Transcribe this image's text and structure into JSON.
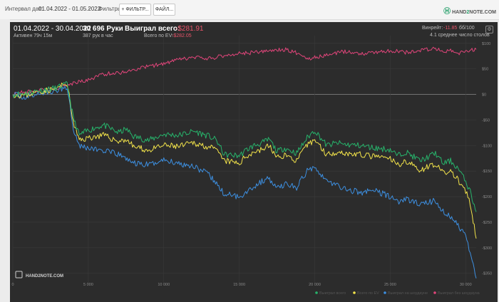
{
  "toolbar": {
    "date_label": "Интервал дат:",
    "date_value": "01.04.2022 - 01.05.2022",
    "filters_label": "Фильтры:",
    "filter_button": "+ ФИЛЬТР...",
    "file_button": "ФАЙЛ...",
    "logo_prefix": "HAND",
    "logo_two": "2",
    "logo_suffix": "NOTE.COM"
  },
  "summary": {
    "period": "01.04.2022 - 30.04.2022",
    "active": "Активен 79ч 15м",
    "hands": "30 696 Руки",
    "hands_per_hour": "387 рук в час",
    "won_label": "Выиграл всего:",
    "won_value": "-$281.91",
    "ev_label": "Всего по EV:",
    "ev_value": "-$282.05",
    "winrate_label": "Винрейт:",
    "winrate_value": "-11.85",
    "winrate_bb": "бб/100",
    "avg_tables": "4.1 среднее число столов"
  },
  "watermark": "HAND2NOTE.COM",
  "colors": {
    "won": "#27b36b",
    "ev": "#f2e34a",
    "showdown": "#3d8fe0",
    "nonshowdown": "#e0457a",
    "panel": "#2c2c2c"
  },
  "chart_data": {
    "type": "line",
    "x_ticks": [
      "0",
      "5 000",
      "10 000",
      "15 000",
      "20 000",
      "25 000",
      "30 000"
    ],
    "y_ticks": [
      "$100",
      "$50",
      "$0",
      "-$50",
      "-$100",
      "-$150",
      "-$200",
      "-$250",
      "-$300",
      "-$350"
    ],
    "xlim": [
      0,
      30696
    ],
    "ylim": [
      -370,
      115
    ],
    "grid": true,
    "legend_position": "bottom-right",
    "series": [
      {
        "name": "Выиграл всего",
        "color": "#27b36b",
        "points": [
          [
            0,
            0
          ],
          [
            800,
            2
          ],
          [
            1800,
            8
          ],
          [
            2800,
            12
          ],
          [
            3600,
            20
          ],
          [
            4000,
            -45
          ],
          [
            4400,
            -80
          ],
          [
            5000,
            -70
          ],
          [
            6000,
            -60
          ],
          [
            7000,
            -75
          ],
          [
            7500,
            -68
          ],
          [
            8000,
            -82
          ],
          [
            9000,
            -90
          ],
          [
            10000,
            -78
          ],
          [
            11000,
            -80
          ],
          [
            12000,
            -72
          ],
          [
            13000,
            -82
          ],
          [
            13500,
            -90
          ],
          [
            14000,
            -118
          ],
          [
            15000,
            -120
          ],
          [
            15500,
            -108
          ],
          [
            16000,
            -100
          ],
          [
            16500,
            -95
          ],
          [
            17000,
            -88
          ],
          [
            17500,
            -112
          ],
          [
            18000,
            -105
          ],
          [
            18800,
            -115
          ],
          [
            19500,
            -85
          ],
          [
            20000,
            -70
          ],
          [
            20800,
            -100
          ],
          [
            21500,
            -95
          ],
          [
            22000,
            -98
          ],
          [
            23000,
            -100
          ],
          [
            24000,
            -105
          ],
          [
            25000,
            -108
          ],
          [
            25500,
            -120
          ],
          [
            26000,
            -112
          ],
          [
            27000,
            -130
          ],
          [
            28000,
            -115
          ],
          [
            28500,
            -135
          ],
          [
            29000,
            -130
          ],
          [
            29500,
            -145
          ],
          [
            30000,
            -170
          ],
          [
            30300,
            -190
          ],
          [
            30696,
            -230
          ]
        ]
      },
      {
        "name": "Всего по EV",
        "color": "#f2e34a",
        "points": [
          [
            0,
            0
          ],
          [
            800,
            -2
          ],
          [
            1800,
            6
          ],
          [
            2800,
            10
          ],
          [
            3600,
            22
          ],
          [
            4000,
            -55
          ],
          [
            4400,
            -90
          ],
          [
            5000,
            -85
          ],
          [
            6000,
            -80
          ],
          [
            7000,
            -92
          ],
          [
            7500,
            -88
          ],
          [
            8000,
            -102
          ],
          [
            9000,
            -110
          ],
          [
            10000,
            -100
          ],
          [
            11000,
            -102
          ],
          [
            12000,
            -95
          ],
          [
            13000,
            -103
          ],
          [
            13500,
            -110
          ],
          [
            14000,
            -130
          ],
          [
            15000,
            -135
          ],
          [
            15500,
            -120
          ],
          [
            16000,
            -112
          ],
          [
            16500,
            -108
          ],
          [
            17000,
            -100
          ],
          [
            17500,
            -125
          ],
          [
            18000,
            -118
          ],
          [
            18800,
            -130
          ],
          [
            19500,
            -100
          ],
          [
            20000,
            -88
          ],
          [
            20800,
            -118
          ],
          [
            21500,
            -112
          ],
          [
            22000,
            -115
          ],
          [
            23000,
            -118
          ],
          [
            24000,
            -122
          ],
          [
            25000,
            -126
          ],
          [
            25500,
            -138
          ],
          [
            26000,
            -130
          ],
          [
            27000,
            -148
          ],
          [
            28000,
            -135
          ],
          [
            28500,
            -155
          ],
          [
            29000,
            -150
          ],
          [
            29500,
            -168
          ],
          [
            30000,
            -190
          ],
          [
            30300,
            -215
          ],
          [
            30696,
            -282
          ]
        ]
      },
      {
        "name": "Выиграл на шоудауне",
        "color": "#3d8fe0",
        "points": [
          [
            0,
            0
          ],
          [
            800,
            -6
          ],
          [
            1800,
            2
          ],
          [
            2800,
            6
          ],
          [
            3600,
            15
          ],
          [
            4000,
            -65
          ],
          [
            4400,
            -100
          ],
          [
            5000,
            -105
          ],
          [
            6000,
            -110
          ],
          [
            7000,
            -118
          ],
          [
            7500,
            -125
          ],
          [
            8000,
            -135
          ],
          [
            9000,
            -138
          ],
          [
            10000,
            -128
          ],
          [
            11000,
            -135
          ],
          [
            12000,
            -140
          ],
          [
            13000,
            -158
          ],
          [
            13500,
            -175
          ],
          [
            14000,
            -195
          ],
          [
            15000,
            -200
          ],
          [
            15500,
            -190
          ],
          [
            16000,
            -180
          ],
          [
            16500,
            -170
          ],
          [
            17000,
            -165
          ],
          [
            17500,
            -185
          ],
          [
            18000,
            -175
          ],
          [
            18800,
            -182
          ],
          [
            19500,
            -150
          ],
          [
            20000,
            -140
          ],
          [
            20800,
            -170
          ],
          [
            21500,
            -178
          ],
          [
            22000,
            -185
          ],
          [
            23000,
            -192
          ],
          [
            24000,
            -188
          ],
          [
            25000,
            -200
          ],
          [
            25500,
            -210
          ],
          [
            26000,
            -205
          ],
          [
            27000,
            -215
          ],
          [
            28000,
            -208
          ],
          [
            28500,
            -230
          ],
          [
            29000,
            -240
          ],
          [
            29500,
            -255
          ],
          [
            30000,
            -280
          ],
          [
            30300,
            -310
          ],
          [
            30696,
            -360
          ]
        ]
      },
      {
        "name": "Выиграл без шоудауна",
        "color": "#e0457a",
        "points": [
          [
            0,
            0
          ],
          [
            800,
            5
          ],
          [
            1800,
            8
          ],
          [
            2800,
            12
          ],
          [
            3600,
            18
          ],
          [
            4000,
            22
          ],
          [
            5000,
            28
          ],
          [
            6000,
            40
          ],
          [
            7000,
            42
          ],
          [
            8000,
            48
          ],
          [
            9000,
            55
          ],
          [
            10000,
            60
          ],
          [
            11000,
            68
          ],
          [
            12000,
            72
          ],
          [
            13000,
            70
          ],
          [
            14000,
            76
          ],
          [
            15000,
            80
          ],
          [
            16000,
            82
          ],
          [
            17000,
            85
          ],
          [
            18000,
            88
          ],
          [
            19000,
            80
          ],
          [
            19500,
            70
          ],
          [
            20000,
            72
          ],
          [
            21000,
            78
          ],
          [
            22000,
            84
          ],
          [
            23000,
            80
          ],
          [
            24000,
            82
          ],
          [
            25000,
            86
          ],
          [
            26000,
            82
          ],
          [
            27000,
            86
          ],
          [
            28000,
            90
          ],
          [
            28500,
            82
          ],
          [
            29000,
            86
          ],
          [
            29500,
            80
          ],
          [
            30000,
            84
          ],
          [
            30696,
            88
          ]
        ]
      }
    ]
  }
}
